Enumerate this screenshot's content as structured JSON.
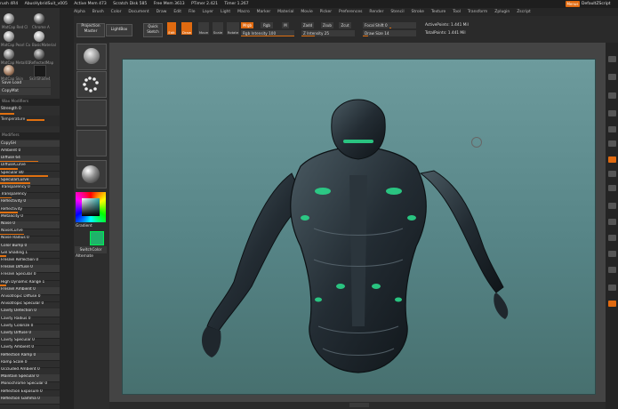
{
  "titlebar": {
    "app": "rush 4R4",
    "project": "AbusHybridSuit_v005",
    "active_mem": "Active Mem 473",
    "scratch_disk": "Scratch Disk 585",
    "free_mem": "Free Mem 3613",
    "ptimer": "PTimer 2.421",
    "timer": "Timer 1.267",
    "menus_btn": "Menus",
    "zscript": "DefaultZScript"
  },
  "menu": [
    "Alpha",
    "Brush",
    "Color",
    "Document",
    "Draw",
    "Edit",
    "File",
    "Layer",
    "Light",
    "Macro",
    "Marker",
    "Material",
    "Movie",
    "Picker",
    "Preferences",
    "Render",
    "Stencil",
    "Stroke",
    "Texture",
    "Tool",
    "Transform",
    "Zplugin",
    "Zscript"
  ],
  "shelf": {
    "projection_master": "Projection Master",
    "lightbox": "LightBox",
    "quick_sketch": "Quick Sketch",
    "edit": "Edit",
    "draw": "Draw",
    "move": "Move",
    "scale": "Scale",
    "rotate": "Rotate",
    "mrgb": "Mrgb",
    "rgb": "Rgb",
    "m": "M",
    "zadd": "Zadd",
    "zsub": "Zsub",
    "zcut": "Zcut",
    "focal_shift": "Focal Shift 0",
    "rgb_intensity": "Rgb Intensity 100",
    "z_intensity": "Z Intensity 25",
    "draw_size": "Draw Size 14",
    "active_points": "ActivePoints: 1.441 Mil",
    "total_points": "TotalPoints: 1.441 Mil"
  },
  "left_top": {
    "items": [
      "MatCap Red Cl",
      "Chrome A",
      "MatCap Pearl Ca",
      "BasicMaterial",
      "MatCap Gray",
      "BasicMaterial2",
      "MatCap Metal01",
      "ReflectedMap",
      "MatCap Skin",
      "SkinShade4"
    ],
    "save_load": "Save Load",
    "copymat": "CopyMat",
    "wax": "Wax Modifiers",
    "strength": "Strength 0",
    "temperature": "Temperature",
    "modifiers": "Modifiers",
    "copysh": "CopySH"
  },
  "rows": [
    {
      "label": "Ambient 0",
      "fill": 0.0
    },
    {
      "label": "Diffuse 64",
      "fill": 0.64
    },
    {
      "label": "DiffuseCurve",
      "fill": 0.3
    },
    {
      "label": "Specular 80",
      "fill": 0.8
    },
    {
      "label": "SpecularCurve",
      "fill": 0.5
    },
    {
      "label": "Transparency 0",
      "fill": 0.0
    },
    {
      "label": "Transparency",
      "fill": 0.2
    },
    {
      "label": "Reflectivity 0",
      "fill": 0.0
    },
    {
      "label": "Reflectivity",
      "fill": 0.3
    },
    {
      "label": "Metalicity 0",
      "fill": 0.0
    },
    {
      "label": "Noise 0",
      "fill": 0.0
    },
    {
      "label": "NoiseCurve",
      "fill": 0.4
    },
    {
      "label": "Noise Radius 0",
      "fill": 0.0
    },
    {
      "label": "Color Bump 0",
      "fill": 0.0
    },
    {
      "label": "Gel Shading 1",
      "fill": 0.1
    },
    {
      "label": "Fresnel Reflection 0",
      "fill": 0.0
    },
    {
      "label": "Fresnel Diffuse 0",
      "fill": 0.0
    },
    {
      "label": "Fresnel Specular 0",
      "fill": 0.0
    },
    {
      "label": "High Dynamic Range 1",
      "fill": 0.1
    },
    {
      "label": "Fresnel Ambient 0",
      "fill": 0.0
    },
    {
      "label": "Anisotropic Diffuse 0",
      "fill": 0.0
    },
    {
      "label": "Anisotropic Specular 0",
      "fill": 0.0
    },
    {
      "label": "Cavity Detection 0",
      "fill": 0.0
    },
    {
      "label": "Cavity Radius 0",
      "fill": 0.0
    },
    {
      "label": "Cavity Colorize 0",
      "fill": 0.0
    },
    {
      "label": "Cavity Diffuse 0",
      "fill": 0.0
    },
    {
      "label": "Cavity Specular 0",
      "fill": 0.0
    },
    {
      "label": "Cavity Ambient 0",
      "fill": 0.0
    },
    {
      "label": "Reflection Ramp 0",
      "fill": 0.0
    },
    {
      "label": "Ramp Scale 0",
      "fill": 0.0
    },
    {
      "label": "Occluded Ambient 0",
      "fill": 0.0
    },
    {
      "label": "Maintain Specular 0",
      "fill": 0.0
    },
    {
      "label": "Monochrome Specular 0",
      "fill": 0.0
    },
    {
      "label": "Reflection Exposure 0",
      "fill": 0.0
    },
    {
      "label": "Reflection Gamma 0",
      "fill": 0.0
    }
  ],
  "tooltray": {
    "gradient": "Gradient",
    "switchcolor": "SwitchColor",
    "alternate": "Alternate"
  },
  "colors": {
    "accent": "#e06a10",
    "canvas_top": "#6d9b9d",
    "canvas_bottom": "#47706f",
    "swatch": "#1fb26a"
  }
}
